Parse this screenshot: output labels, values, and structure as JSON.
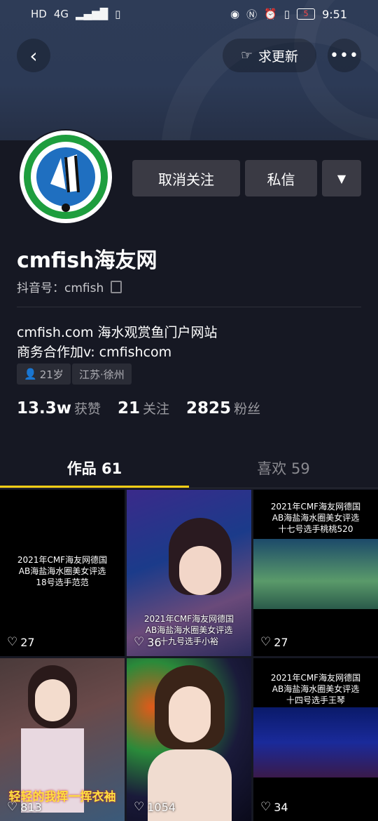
{
  "status_bar": {
    "left_icons": [
      "HD",
      "4G",
      "signal-icon",
      "battery-small-icon"
    ],
    "right_icons": [
      "eye-icon",
      "nfc-icon",
      "alarm-icon",
      "vibrate-icon"
    ],
    "battery": "5",
    "time": "9:51"
  },
  "header": {
    "update_label": "求更新"
  },
  "profile": {
    "unfollow_label": "取消关注",
    "message_label": "私信",
    "name": "cmfish海友网",
    "douyin_id": "抖音号：cmfish",
    "bio_line1": "cmfish.com 海水观赏鱼门户网站",
    "bio_line2": "商务合作加v: cmfishcom",
    "tags": {
      "age": "21岁",
      "location": "江苏·徐州"
    },
    "stats": [
      {
        "value": "13.3w",
        "label": "获赞"
      },
      {
        "value": "21",
        "label": "关注"
      },
      {
        "value": "2825",
        "label": "粉丝"
      }
    ]
  },
  "tabs": {
    "works": "作品 61",
    "likes": "喜欢 59"
  },
  "videos": [
    {
      "likes": "27",
      "caption_lines": [
        "2021年CMF海友网德国",
        "AB海盐海水圈美女评选",
        "18号选手范范"
      ]
    },
    {
      "likes": "36",
      "caption_lines": [
        "2021年CMF海友网德国",
        "AB海盐海水圈美女评选",
        "十九号选手小裕"
      ]
    },
    {
      "likes": "27",
      "caption_lines": [
        "2021年CMF海友网德国",
        "AB海盐海水圈美女评选",
        "十七号选手桃桃520"
      ]
    },
    {
      "likes": "813",
      "caption_lines": [
        "轻轻的我挥一挥衣袖"
      ]
    },
    {
      "likes": "1054",
      "caption_lines": []
    },
    {
      "likes": "34",
      "caption_lines": [
        "2021年CMF海友网德国",
        "AB海盐海水圈美女评选",
        "十四号选手王琴"
      ]
    }
  ],
  "colors": {
    "background": "#161823",
    "accent": "#face15",
    "age_icon": "#fe2c55"
  }
}
